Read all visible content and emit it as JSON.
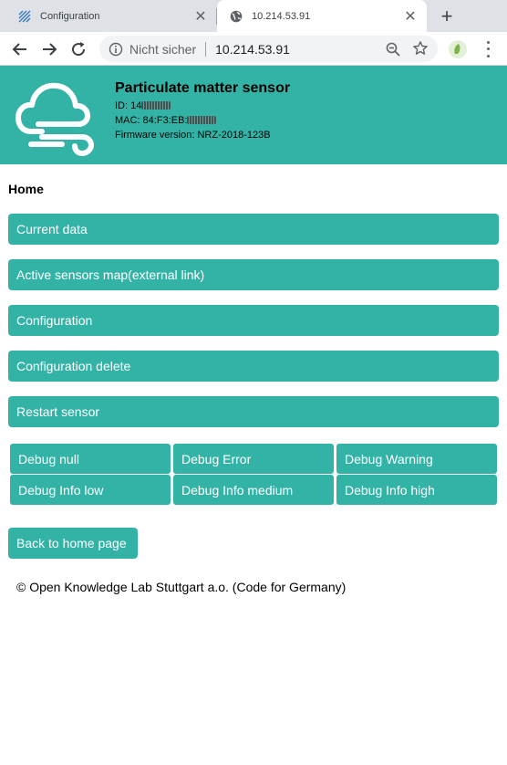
{
  "browser": {
    "tabs": [
      {
        "title": "Configuration",
        "active": false
      },
      {
        "title": "10.214.53.91",
        "active": true
      }
    ],
    "omnibox": {
      "security_label": "Nicht sicher",
      "url": "10.214.53.91"
    }
  },
  "header": {
    "title": "Particulate matter sensor",
    "id_label": "ID: 14",
    "mac_label": "MAC: 84:F3:EB:",
    "firmware_label": "Firmware version: NRZ-2018-123B",
    "accent_color": "#33b3a6"
  },
  "page": {
    "heading": "Home",
    "menu": [
      "Current data",
      "Active sensors map(external link)",
      "Configuration",
      "Configuration delete",
      "Restart sensor"
    ],
    "debug_buttons": [
      "Debug null",
      "Debug Error",
      "Debug Warning",
      "Debug Info low",
      "Debug Info medium",
      "Debug Info high"
    ],
    "back_button": "Back to home page",
    "footer": "© Open Knowledge Lab Stuttgart a.o. (Code for Germany)"
  }
}
